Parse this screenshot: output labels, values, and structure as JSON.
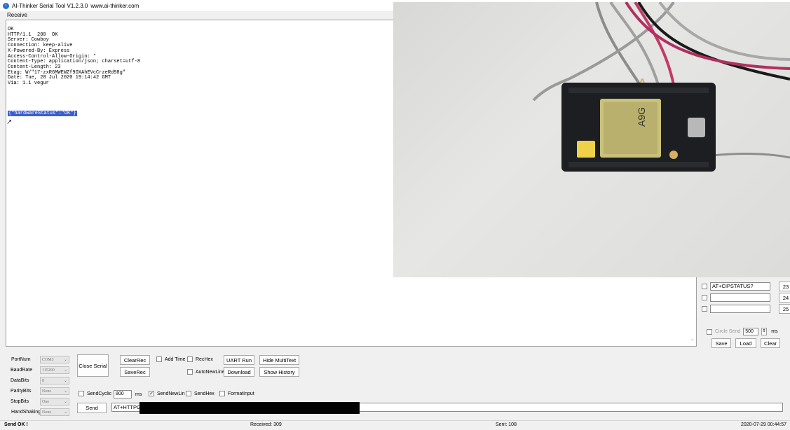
{
  "window": {
    "title": "AI-Thinker Serial Tool V1.2.3.0",
    "website": "www.ai-thinker.com",
    "icon": "ai-thinker-logo-icon"
  },
  "receive": {
    "label": "Receive",
    "text": "OK\nHTTP/1.1  200  OK\nServer: Cowboy\nConnection: keep-alive\nX-Powered-By: Express\nAccess-Control-Allow-Origin: *\nContent-Type: application/json; charset=utf-8\nContent-Length: 23\nEtag: W/\"17-zxR6MWEWZf9OXAhEVcCrzeRd98g\"\nDate: Tue, 28 Jul 2020 19:14:42 GMT\nVia: 1.1 vegur",
    "selected_line": "{\"hardwareStatus\":\"OK\"}"
  },
  "multitext": {
    "rows": [
      {
        "value": "AT+CIPSTATUS?",
        "number": "23"
      },
      {
        "value": "",
        "number": "24"
      },
      {
        "value": "",
        "number": "25"
      }
    ],
    "circle_send_label": "Circle Send",
    "circle_interval": "500",
    "ms_label": "ms",
    "save_label": "Save",
    "load_label": "Load",
    "clear_label": "Clear"
  },
  "port": {
    "portnum_label": "PortNum",
    "portnum_value": "COM3",
    "baudrate_label": "BaudRate",
    "baudrate_value": "115200",
    "databits_label": "DataBits",
    "databits_value": "8",
    "paritybits_label": "ParityBits",
    "paritybits_value": "None",
    "stopbits_label": "StopBits",
    "stopbits_value": "One",
    "handshaking_label": "HandShaking",
    "handshaking_value": "None"
  },
  "controls": {
    "close_serial": "Close Serial",
    "clearrec": "ClearRec",
    "saverec": "SaveRec",
    "add_time": "Add Time",
    "rechex": "RecHex",
    "autonewline": "AutoNewLine",
    "uart_run": "UART Run",
    "download": "Download",
    "hide_multitext": "Hide MultiText",
    "show_history": "Show History"
  },
  "send": {
    "sendcyclic_label": "SendCyclic",
    "cyclic_interval": "800",
    "ms_label": "ms",
    "sendnewline_label": "SendNewLin",
    "sendnewline_checked": true,
    "sendhex_label": "SendHex",
    "formatinput_label": "FormatInput",
    "send_button": "Send",
    "command_text": "AT+HTTPGET"
  },
  "status": {
    "message": "Send OK !",
    "received": "Received: 309",
    "sent": "Sent: 108",
    "datetime": "2020-07-29 00:44:57"
  },
  "colors": {
    "selection": "#3a5fcd",
    "window_bg": "#f0f0f0",
    "board": "#1c1e22"
  }
}
